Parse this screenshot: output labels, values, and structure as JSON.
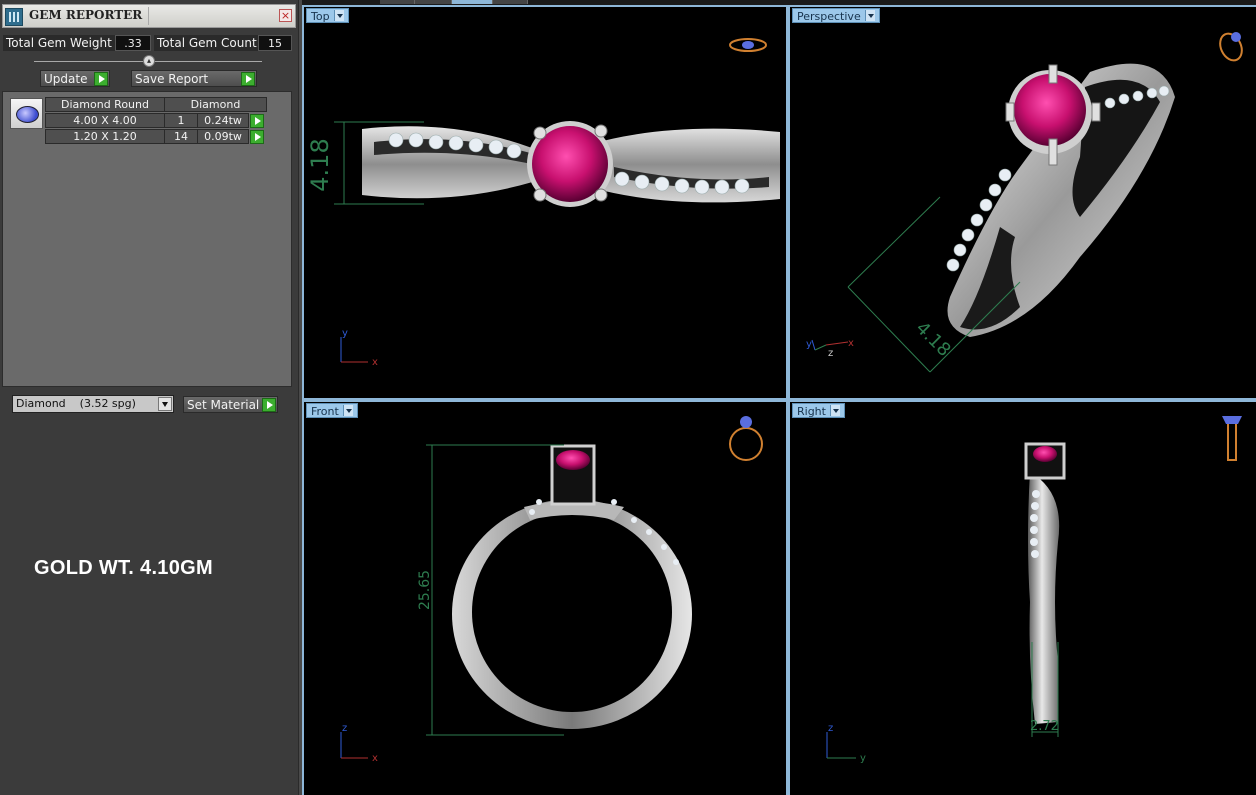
{
  "panel": {
    "title": "GEM REPORTER",
    "total_gem_weight_label": "Total Gem Weight",
    "total_gem_weight_value": ".33",
    "total_gem_count_label": "Total Gem Count",
    "total_gem_count_value": "15",
    "update_label": "Update",
    "save_report_label": "Save Report",
    "table": {
      "headers": [
        "Diamond Round",
        "Diamond"
      ],
      "rows": [
        {
          "size": "4.00 X 4.00",
          "count": "1",
          "weight": "0.24tw"
        },
        {
          "size": "1.20 X 1.20",
          "count": "14",
          "weight": "0.09tw"
        }
      ]
    },
    "material_select": "Diamond    (3.52 spg)",
    "set_material_label": "Set Material",
    "gold_weight_note": "GOLD WT. 4.10GM"
  },
  "viewports": {
    "top": {
      "label": "Top",
      "dimension": "4.18",
      "axis_v": "y",
      "axis_h": "x"
    },
    "perspective": {
      "label": "Perspective",
      "dimension": "4.18",
      "axis_a": "y",
      "axis_b": "z",
      "axis_c": "x"
    },
    "front": {
      "label": "Front",
      "dimension": "25.65",
      "axis_v": "z",
      "axis_h": "x"
    },
    "right": {
      "label": "Right",
      "dimension": "2.72",
      "axis_v": "z",
      "axis_h": "y"
    }
  },
  "colors": {
    "viewport_bg": "#000000",
    "viewport_label_bg": "#9cc8ea",
    "metal": "#b9b9b9",
    "ruby": "#d0147a",
    "dimension_green": "#2e7d4f",
    "accent_green_button": "#3cae2f"
  }
}
